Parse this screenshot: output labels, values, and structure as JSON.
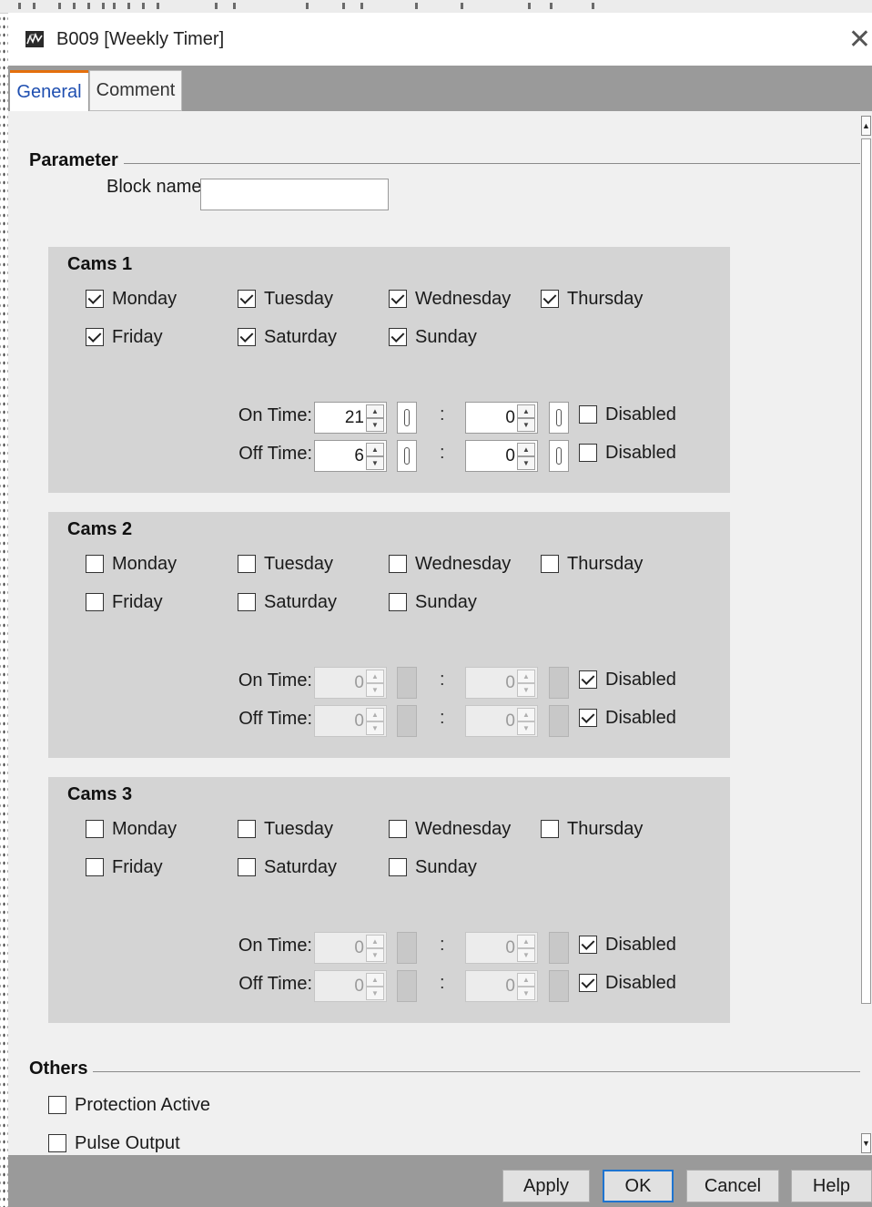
{
  "window": {
    "title": "B009 [Weekly Timer]",
    "icon": "weekly-timer-block-icon",
    "close_icon": "close-icon",
    "close_glyph": "✕"
  },
  "tabs": [
    {
      "label": "General",
      "active": true
    },
    {
      "label": "Comment",
      "active": false
    }
  ],
  "parameter": {
    "section_title": "Parameter",
    "block_name_label": "Block name:",
    "block_name_value": ""
  },
  "labels": {
    "on_time": "On Time:",
    "off_time": "Off Time:",
    "colon": ":",
    "disabled": "Disabled"
  },
  "cams": [
    {
      "title": "Cams 1",
      "days": [
        {
          "label": "Monday",
          "checked": true
        },
        {
          "label": "Tuesday",
          "checked": true
        },
        {
          "label": "Wednesday",
          "checked": true
        },
        {
          "label": "Thursday",
          "checked": true
        },
        {
          "label": "Friday",
          "checked": true
        },
        {
          "label": "Saturday",
          "checked": true
        },
        {
          "label": "Sunday",
          "checked": true
        }
      ],
      "on_time": {
        "hours": "21",
        "minutes": "0",
        "disabled": false
      },
      "off_time": {
        "hours": "6",
        "minutes": "0",
        "disabled": false
      }
    },
    {
      "title": "Cams 2",
      "days": [
        {
          "label": "Monday",
          "checked": false
        },
        {
          "label": "Tuesday",
          "checked": false
        },
        {
          "label": "Wednesday",
          "checked": false
        },
        {
          "label": "Thursday",
          "checked": false
        },
        {
          "label": "Friday",
          "checked": false
        },
        {
          "label": "Saturday",
          "checked": false
        },
        {
          "label": "Sunday",
          "checked": false
        }
      ],
      "on_time": {
        "hours": "0",
        "minutes": "0",
        "disabled": true
      },
      "off_time": {
        "hours": "0",
        "minutes": "0",
        "disabled": true
      }
    },
    {
      "title": "Cams 3",
      "days": [
        {
          "label": "Monday",
          "checked": false
        },
        {
          "label": "Tuesday",
          "checked": false
        },
        {
          "label": "Wednesday",
          "checked": false
        },
        {
          "label": "Thursday",
          "checked": false
        },
        {
          "label": "Friday",
          "checked": false
        },
        {
          "label": "Saturday",
          "checked": false
        },
        {
          "label": "Sunday",
          "checked": false
        }
      ],
      "on_time": {
        "hours": "0",
        "minutes": "0",
        "disabled": true
      },
      "off_time": {
        "hours": "0",
        "minutes": "0",
        "disabled": true
      }
    }
  ],
  "others": {
    "section_title": "Others",
    "options": [
      {
        "label": "Protection Active",
        "checked": false
      },
      {
        "label": "Pulse Output",
        "checked": false
      }
    ]
  },
  "footer": {
    "apply": "Apply",
    "ok": "OK",
    "cancel": "Cancel",
    "help": "Help"
  },
  "scrollbar": {
    "up_glyph": "▲",
    "down_glyph": "▼"
  },
  "colors": {
    "active_tab_text": "#1f4fb0",
    "active_tab_accent": "#e46f0c",
    "ok_button_border": "#1e74d0",
    "panel_background": "#d4d4d4",
    "bar_background": "#9a9a9a"
  }
}
